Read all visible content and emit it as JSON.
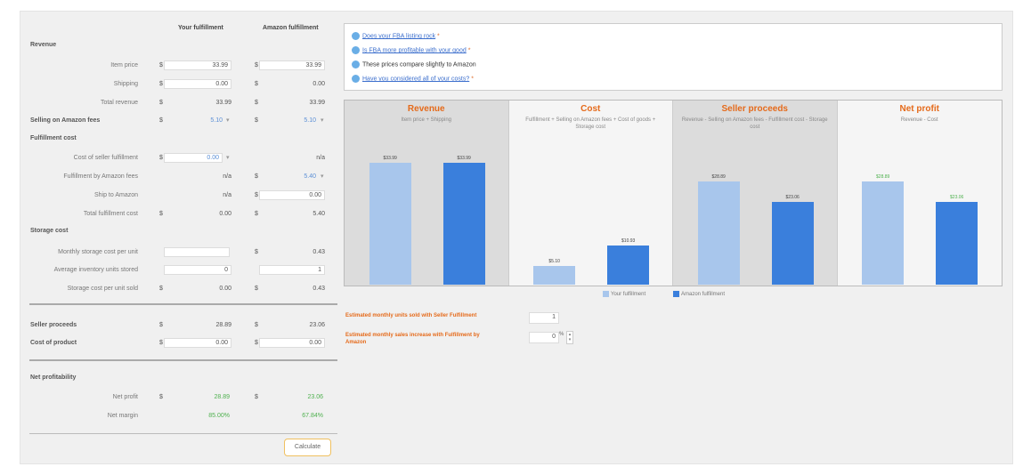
{
  "columns": {
    "your": "Your fulfillment",
    "amazon": "Amazon fulfillment"
  },
  "sections": {
    "revenue": "Revenue",
    "fulfillment": "Fulfillment cost",
    "storage": "Storage cost",
    "net": "Net profitability"
  },
  "rows": {
    "item_price": {
      "label": "Item price",
      "your": "33.99",
      "amazon": "33.99"
    },
    "shipping": {
      "label": "Shipping",
      "your": "0.00",
      "amazon": "0.00"
    },
    "total_revenue": {
      "label": "Total revenue",
      "your": "33.99",
      "amazon": "33.99"
    },
    "selling_fees": {
      "label": "Selling on Amazon fees",
      "your": "5.10",
      "amazon": "5.10"
    },
    "cost_of_seller_fulfillment": {
      "label": "Cost of seller fulfillment",
      "your": "0.00",
      "amazon": "n/a"
    },
    "fulfillment_by_amazon_fees": {
      "label": "Fulfillment by Amazon fees",
      "your": "n/a",
      "amazon": "5.40"
    },
    "ship_to_amazon": {
      "label": "Ship to Amazon",
      "your": "n/a",
      "amazon": "0.00"
    },
    "total_fulfillment_cost": {
      "label": "Total fulfillment cost",
      "your": "0.00",
      "amazon": "5.40"
    },
    "monthly_storage_cost": {
      "label": "Monthly storage cost per unit",
      "your": "",
      "amazon": "0.43"
    },
    "average_inventory": {
      "label": "Average inventory units stored",
      "your": "0",
      "amazon": "1"
    },
    "storage_cost_per_unit": {
      "label": "Storage cost per unit sold",
      "your": "0.00",
      "amazon": "0.43"
    },
    "seller_proceeds": {
      "label": "Seller proceeds",
      "your": "28.89",
      "amazon": "23.06"
    },
    "cost_of_product": {
      "label": "Cost of product",
      "your": "0.00",
      "amazon": "0.00"
    },
    "net_profit": {
      "label": "Net profit",
      "your": "28.89",
      "amazon": "23.06"
    },
    "net_margin": {
      "label": "Net margin",
      "your": "85.00%",
      "amazon": "67.84%"
    }
  },
  "dollar": "$",
  "calculate": "Calculate",
  "questions": [
    {
      "text": "Does your FBA listing rock",
      "link": true
    },
    {
      "text": "Is FBA more profitable with your good",
      "link": true
    },
    {
      "text": "These prices compare slightly to Amazon",
      "link": false
    },
    {
      "text": "Have you considered all of your costs?",
      "link": true
    }
  ],
  "chart_data": [
    {
      "type": "bar",
      "title": "Revenue",
      "subtitle": "Item price + Shipping",
      "categories": [
        "Your fulfillment",
        "Amazon fulfillment"
      ],
      "values": [
        33.99,
        33.99
      ],
      "labels": [
        "$33.99",
        "$33.99"
      ],
      "ylim": [
        0,
        40
      ]
    },
    {
      "type": "bar",
      "title": "Cost",
      "subtitle": "Fulfillment + Selling on Amazon fees + Cost of goods + Storage cost",
      "categories": [
        "Your fulfillment",
        "Amazon fulfillment"
      ],
      "values": [
        5.1,
        10.93
      ],
      "labels": [
        "$5.10",
        "$10.93"
      ],
      "ylim": [
        0,
        40
      ]
    },
    {
      "type": "bar",
      "title": "Seller proceeds",
      "subtitle": "Revenue - Selling on Amazon fees - Fulfillment cost - Storage cost",
      "categories": [
        "Your fulfillment",
        "Amazon fulfillment"
      ],
      "values": [
        28.89,
        23.06
      ],
      "labels": [
        "$28.89",
        "$23.06"
      ],
      "ylim": [
        0,
        40
      ]
    },
    {
      "type": "bar",
      "title": "Net profit",
      "subtitle": "Revenue - Cost",
      "categories": [
        "Your fulfillment",
        "Amazon fulfillment"
      ],
      "values": [
        28.89,
        23.06
      ],
      "labels": [
        "$28.89",
        "$23.06"
      ],
      "ylim": [
        0,
        40
      ]
    }
  ],
  "legend": [
    {
      "name": "Your fulfillment",
      "color": "#a8c6ec"
    },
    {
      "name": "Amazon fulfillment",
      "color": "#3a7fdc"
    }
  ],
  "estimates": {
    "units_label": "Estimated monthly units sold with Seller Fulfillment",
    "units_value": "1",
    "sales_label": "Estimated monthly sales increase with Fulfillment by Amazon",
    "sales_value": "0",
    "percent": "%"
  },
  "colors": {
    "accent": "#e56a1a",
    "link": "#3c6fcd",
    "positive": "#4fb14f"
  }
}
